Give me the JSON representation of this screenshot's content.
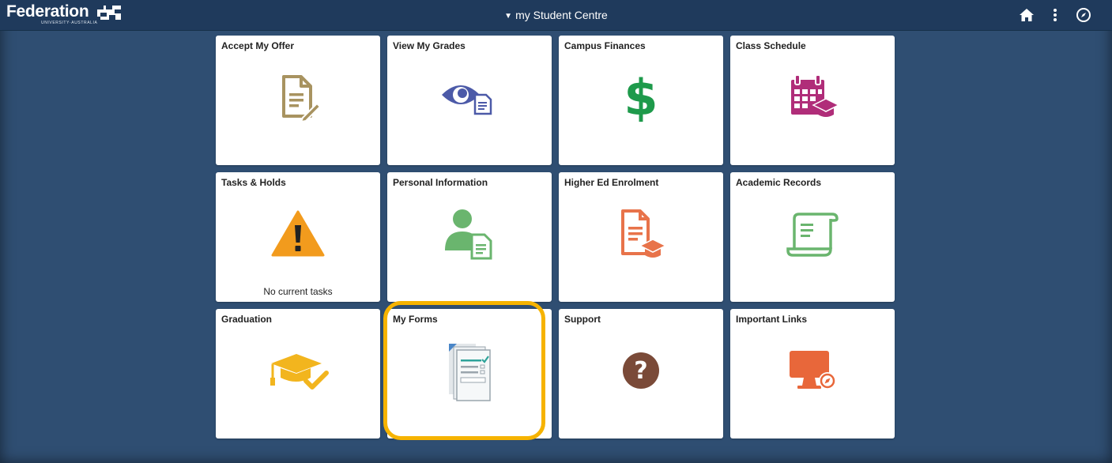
{
  "header": {
    "logo_text": "Federation",
    "logo_subtext": "UNIVERSITY·AUSTRALIA",
    "title": "my Student Centre",
    "icons": [
      "home-icon",
      "more-actions-icon",
      "navbar-compass-icon"
    ]
  },
  "tiles": [
    {
      "label": "Accept My Offer",
      "icon": "document-edit-icon",
      "color": "#a89360"
    },
    {
      "label": "View My Grades",
      "icon": "eye-document-icon",
      "color": "#4c5aa8"
    },
    {
      "label": "Campus Finances",
      "icon": "dollar-icon",
      "color": "#1e9a4b"
    },
    {
      "label": "Class Schedule",
      "icon": "calendar-graduation-icon",
      "color": "#b02d79"
    },
    {
      "label": "Tasks & Holds",
      "icon": "warning-icon",
      "color": "#f29b1d",
      "footer": "No current tasks"
    },
    {
      "label": "Personal Information",
      "icon": "person-document-icon",
      "color": "#6ab56e"
    },
    {
      "label": "Higher Ed Enrolment",
      "icon": "document-graduation-icon",
      "color": "#e8734a"
    },
    {
      "label": "Academic Records",
      "icon": "scroll-icon",
      "color": "#6ab56e"
    },
    {
      "label": "Graduation",
      "icon": "graduation-cap-icon",
      "color": "#f2b51e"
    },
    {
      "label": "My Forms",
      "icon": "forms-checklist-icon",
      "color": "#2fa39a"
    },
    {
      "label": "Support",
      "icon": "question-icon",
      "color": "#7a4a38"
    },
    {
      "label": "Important Links",
      "icon": "monitor-link-icon",
      "color": "#e8673a"
    }
  ],
  "highlight": {
    "tile": "My Forms",
    "color": "#f6b300"
  }
}
